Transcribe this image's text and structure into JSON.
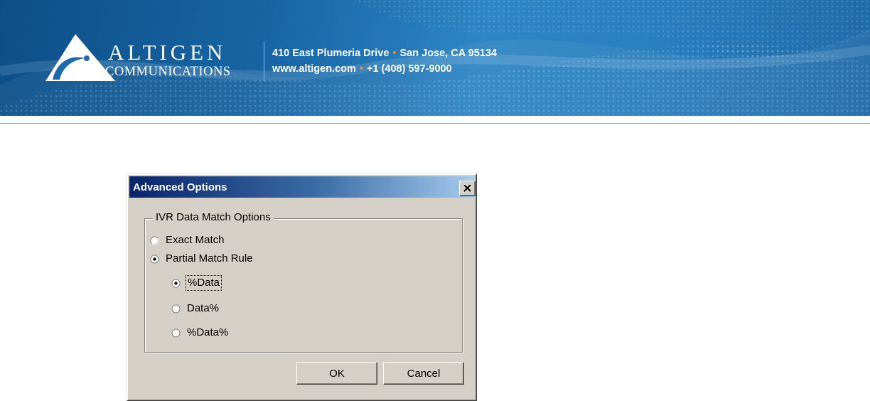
{
  "banner": {
    "brand_name": "ALTIGEN",
    "brand_sub": "COMMUNICATIONS",
    "address_line1_a": "410 East Plumeria Drive",
    "address_line1_b": "San Jose, CA 95134",
    "address_line2_a": "www.altigen.com",
    "address_line2_b": "+1 (408) 597-9000",
    "separator": "•",
    "icons": [
      "altigen-logo-icon"
    ]
  },
  "colors": {
    "banner_blue": "#1e6aa9",
    "accent_orange": "#f08a2c",
    "dialog_face": "#d4d0c8",
    "titlebar_start": "#0a246a",
    "titlebar_end": "#a6caf0"
  },
  "dialog": {
    "title": "Advanced Options",
    "close_label": "X",
    "group_label": "IVR Data Match Options",
    "options": {
      "exact_match": {
        "label": "Exact Match",
        "selected": false
      },
      "partial_match": {
        "label": "Partial Match Rule",
        "selected": true
      },
      "pct_data": {
        "label": "%Data",
        "selected": true
      },
      "data_pct": {
        "label": "Data%",
        "selected": false
      },
      "pct_data_pct": {
        "label": "%Data%",
        "selected": false
      }
    },
    "ok_label": "OK",
    "cancel_label": "Cancel"
  }
}
